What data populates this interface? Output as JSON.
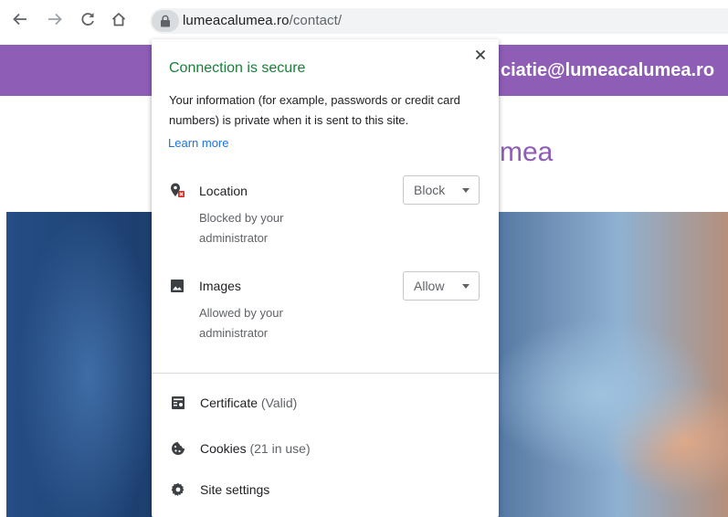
{
  "browser": {
    "url_domain": "lumeacalumea.ro",
    "url_path": "/contact/"
  },
  "page": {
    "email": "ciatie@lumeacalumea.ro",
    "logo_fragment": "mea",
    "accent_color": "#8e5db6"
  },
  "popup": {
    "title": "Connection is secure",
    "description": "Your information (for example, passwords or credit card numbers) is private when it is sent to this site.",
    "learn_more": "Learn more",
    "permissions": [
      {
        "label": "Location",
        "sub": "Blocked by your administrator",
        "value": "Block",
        "icon": "location-blocked-icon"
      },
      {
        "label": "Images",
        "sub": "Allowed by your administrator",
        "value": "Allow",
        "icon": "image-icon"
      }
    ],
    "rows": [
      {
        "label": "Certificate",
        "detail": "(Valid)",
        "icon": "certificate-icon"
      },
      {
        "label": "Cookies",
        "detail": "(21 in use)",
        "icon": "cookie-icon"
      },
      {
        "label": "Site settings",
        "detail": "",
        "icon": "gear-icon"
      }
    ]
  }
}
